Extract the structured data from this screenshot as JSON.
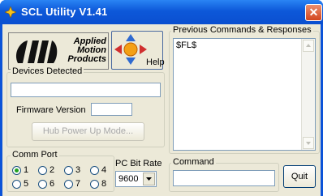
{
  "window": {
    "title": "SCL Utility  V1.41"
  },
  "logo": {
    "line1": "Applied",
    "line2": "Motion",
    "line3": "Products"
  },
  "help_button": {
    "label": "Help"
  },
  "devices": {
    "legend": "Devices Detected",
    "firmware_label": "Firmware Version",
    "firmware_value": "",
    "hub_button": "Hub Power Up Mode..."
  },
  "comm_port": {
    "legend": "Comm Port",
    "options": [
      "1",
      "2",
      "3",
      "4",
      "5",
      "6",
      "7",
      "8"
    ],
    "selected": "1"
  },
  "pc_bit_rate": {
    "label": "PC Bit Rate",
    "value": "9600"
  },
  "history": {
    "legend": "Previous Commands & Responses",
    "text": "$FL$"
  },
  "command": {
    "legend": "Command",
    "value": "",
    "quit_button": "Quit"
  },
  "colors": {
    "titlebar": "#0a4fd0",
    "close_button": "#d2451e",
    "panel": "#ece9d8"
  }
}
